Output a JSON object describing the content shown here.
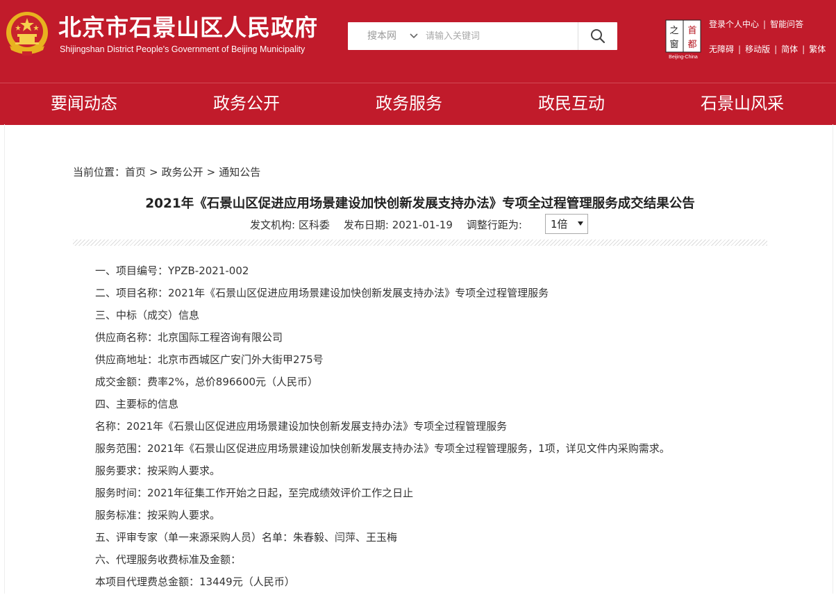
{
  "header": {
    "site_title": "北京市石景山区人民政府",
    "site_subtitle": "Shijingshan District People's Government of Beijing Municipality",
    "search_scope": "搜本网",
    "search_placeholder": "请输入关键词",
    "capital_logo": {
      "chars_left": "之窗",
      "chars_right": "首都",
      "caption": "Beijing-China"
    },
    "top_links_row1": [
      "登录个人中心",
      "智能问答"
    ],
    "top_links_row2": [
      "无障碍",
      "移动版",
      "简体",
      "繁体"
    ],
    "brand_color": "#c11b2b"
  },
  "nav": {
    "items": [
      "要闻动态",
      "政务公开",
      "政务服务",
      "政民互动",
      "石景山风采"
    ]
  },
  "breadcrumb": {
    "prefix": "当前位置：",
    "items": [
      "首页",
      "政务公开",
      "通知公告"
    ],
    "separator": ">"
  },
  "article": {
    "title": "2021年《石景山区促进应用场景建设加快创新发展支持办法》专项全过程管理服务成交结果公告",
    "issuer_label": "发文机构:",
    "issuer": "区科委",
    "date_label": "发布日期:",
    "date": "2021-01-19",
    "spacing_label": "调整行距为:",
    "spacing_value": "1倍",
    "paragraphs": [
      "一、项目编号：YPZB-2021-002",
      "二、项目名称：2021年《石景山区促进应用场景建设加快创新发展支持办法》专项全过程管理服务",
      "三、中标（成交）信息",
      "供应商名称：北京国际工程咨询有限公司",
      "供应商地址：北京市西城区广安门外大街甲275号",
      "成交金额：费率2%，总价896600元（人民币）",
      "四、主要标的信息",
      "名称：2021年《石景山区促进应用场景建设加快创新发展支持办法》专项全过程管理服务",
      "服务范围：2021年《石景山区促进应用场景建设加快创新发展支持办法》专项全过程管理服务，1项，详见文件内采购需求。",
      "服务要求：按采购人要求。",
      "服务时间：2021年征集工作开始之日起，至完成绩效评价工作之日止",
      "服务标准：按采购人要求。",
      "五、评审专家（单一来源采购人员）名单：朱春毅、闫萍、王玉梅",
      "六、代理服务收费标准及金额：",
      "本项目代理费总金额：13449元（人民币）"
    ]
  }
}
